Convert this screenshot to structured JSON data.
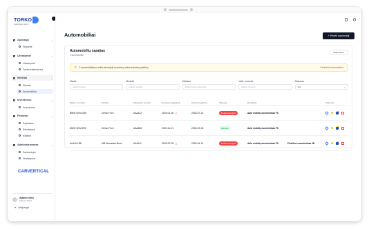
{
  "app": {
    "logo_text": "TORKO",
    "logo_subtext": "automobiliu nuoma"
  },
  "sidebar": {
    "groups": [
      {
        "label": "Apžvalga",
        "items": [
          {
            "label": "Skydelis"
          }
        ]
      },
      {
        "label": "Užsakymai",
        "items": [
          {
            "label": "Užsakymai"
          },
          {
            "label": "Darbo kalendorius"
          }
        ]
      },
      {
        "label": "Ištekliai",
        "items": [
          {
            "label": "Klientai"
          },
          {
            "label": "Automobiliai"
          }
        ]
      },
      {
        "label": "Inventorius",
        "items": [
          {
            "label": "Inventorius"
          }
        ]
      },
      {
        "label": "Finansai",
        "items": [
          {
            "label": "Sąskaitos"
          },
          {
            "label": "Pardavimai"
          },
          {
            "label": "Išlaidos"
          }
        ]
      },
      {
        "label": "Administravimas",
        "items": [
          {
            "label": "Darbuotojai"
          },
          {
            "label": "Nustatymai"
          }
        ]
      }
    ],
    "partner": "CARVERTICAL",
    "user": {
      "name": "Admin Vien",
      "role": "Admin / Torko"
    },
    "logout_label": "Atsijungti"
  },
  "header": {
    "page_title": "Automobiliai",
    "primary_button": "+ Pridėti automobilį"
  },
  "card": {
    "title": "Automobilių sąrašas",
    "subtitle": "3 automobiliai",
    "export_button": "Eksportuoti"
  },
  "warning": {
    "text": "2 automobiliams reikia atnaujinti draudimą arba techninę apžiūrą",
    "link": "Peržiūrėti automobilius"
  },
  "filters": [
    {
      "label": "Marka",
      "placeholder": "Ieškoti markės"
    },
    {
      "label": "Modelis",
      "placeholder": "Ieškoti modelio"
    },
    {
      "label": "Klientas",
      "placeholder": "Ieškoti kliento pavardės"
    },
    {
      "label": "Valst. numeris",
      "placeholder": "Ieškoti numerio"
    },
    {
      "label": "Statusas",
      "value": "Visi"
    }
  ],
  "table": {
    "columns": [
      "Markė ir modelis",
      "Modelis",
      "Valstybinis numeris",
      "Draudimo galiojimas",
      "Techninė apžiūra",
      "Statusas",
      "Draudikas",
      "Veiksmai"
    ],
    "rows": [
      {
        "make": "BMW 520d G30",
        "model": "Zeimu Ford",
        "plate": "AAA112",
        "insurance": "2025-01-30",
        "inspection": "2025-07-22",
        "status": "Reikia atnaujinti",
        "status_type": "red",
        "insurer": "Auto mobilių nuomininkas FS",
        "insurer_extra": ""
      },
      {
        "make": "BMW 320d E90",
        "model": "Zeimu Ford",
        "plate": "AAA652",
        "insurance": "2025-11-01",
        "inspection": "2026-03-13",
        "status": "Aktyvus",
        "status_type": "green",
        "insurer": "Auto mobilių nuomininkas FS",
        "insurer_extra": ""
      },
      {
        "make": "Audi A4 B8",
        "model": "MB Mercedes-Benz",
        "plate": "AAA111",
        "insurance": "2025-02-05",
        "inspection": "2025-04-12",
        "status": "Reikia atnaujinti",
        "status_type": "red",
        "insurer": "Auto mobilių nuomininkas FS",
        "insurer_extra": "Pridėtinė nuomininkas JB"
      }
    ]
  },
  "colors": {
    "accent": "#111827",
    "brand": "#1d4ed8",
    "warning_bg": "#fffbeb",
    "danger": "#ef4444",
    "success": "#15803d"
  }
}
